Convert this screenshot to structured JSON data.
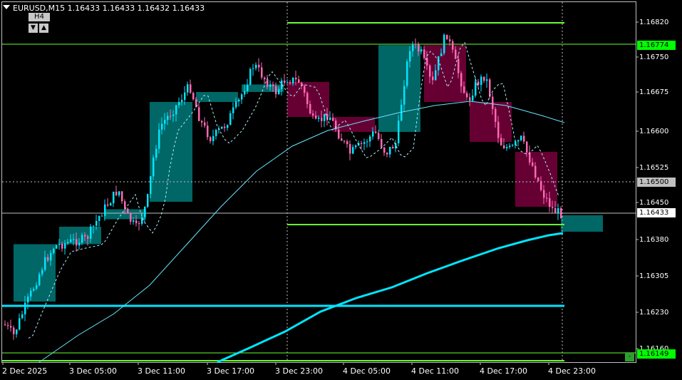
{
  "window": {
    "symbol_line": "EURUSD,M15  1.16433 1.16433 1.16432 1.16433",
    "higher_tf": "H4",
    "btn_down": "▼",
    "btn_up": "▲",
    "minus_btn": "-"
  },
  "price_axis": {
    "ticks": [
      "1.16820",
      "1.16750",
      "1.16675",
      "1.16600",
      "1.16525",
      "1.16450",
      "1.16380",
      "1.16305",
      "1.16230",
      "1.16160"
    ],
    "ticks_y": [
      31,
      80,
      129,
      184,
      235,
      284,
      336,
      387,
      438,
      489
    ],
    "labels": {
      "upper_line": {
        "text": "1.16774",
        "bg": "#00ff00",
        "color": "#000000"
      },
      "mid_line": {
        "text": "1.16500",
        "bg": "#c0c0c0",
        "color": "#000000"
      },
      "current": {
        "text": "1.16433",
        "bg": "#ffffff",
        "color": "#000000"
      },
      "lower_line": {
        "text": "1.16149",
        "bg": "#00ff00",
        "color": "#000000"
      }
    }
  },
  "time_axis": {
    "labels": [
      "2 Dec 2025",
      "3 Dec 05:00",
      "3 Dec 11:00",
      "3 Dec 17:00",
      "3 Dec 23:00",
      "4 Dec 05:00",
      "4 Dec 11:00",
      "4 Dec 17:00",
      "4 Dec 23:00"
    ]
  },
  "colors": {
    "bull_candle": "#00e5ff",
    "bear_candle": "#ff69b4",
    "h4_bull_box": "#006666",
    "h4_bear_box": "#660033",
    "green_level": "#66ff33",
    "cyan_level": "#00e5ff",
    "ma_slow": "#00e5ff",
    "grid_dotted": "#c0c0c0"
  },
  "chart_data": {
    "type": "candlestick",
    "symbol": "EURUSD",
    "timeframe": "M15",
    "current_price": 1.16433,
    "ohlc": {
      "open": 1.16433,
      "high": 1.16433,
      "low": 1.16432,
      "close": 1.16433
    },
    "levels": [
      1.16818,
      1.16774,
      1.165,
      1.16433,
      1.16415,
      1.16245,
      1.16149
    ],
    "h4_boxes": [
      {
        "dir": "bull",
        "open": 1.1626,
        "close": 1.16375
      },
      {
        "dir": "bull",
        "open": 1.16375,
        "close": 1.1641
      },
      {
        "dir": "bull",
        "open": 1.16425,
        "close": 1.16445
      },
      {
        "dir": "bull",
        "open": 1.1646,
        "close": 1.1666
      },
      {
        "dir": "bull",
        "open": 1.1666,
        "close": 1.1668
      },
      {
        "dir": "bull",
        "open": 1.1668,
        "close": 1.16695
      },
      {
        "dir": "bear",
        "open": 1.167,
        "close": 1.1663
      },
      {
        "dir": "bear",
        "open": 1.1663,
        "close": 1.166
      },
      {
        "dir": "bull",
        "open": 1.166,
        "close": 1.16774
      },
      {
        "dir": "bear",
        "open": 1.16774,
        "close": 1.1666
      },
      {
        "dir": "bear",
        "open": 1.1666,
        "close": 1.1658
      },
      {
        "dir": "bear",
        "open": 1.1656,
        "close": 1.1645
      },
      {
        "dir": "bull",
        "open": 1.164,
        "close": 1.16433
      }
    ]
  }
}
